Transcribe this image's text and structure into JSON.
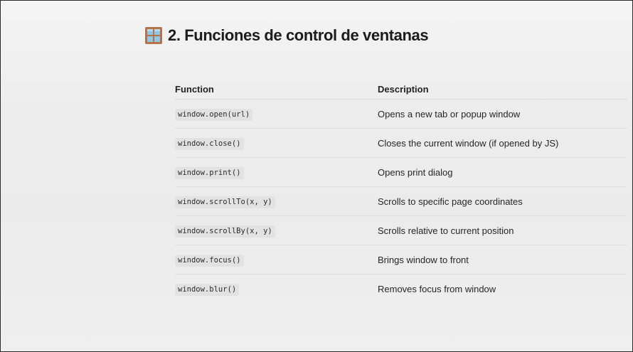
{
  "heading": {
    "icon": "window-icon",
    "title": "2. Funciones de control de ventanas"
  },
  "table": {
    "columns": [
      "Function",
      "Description"
    ],
    "rows": [
      {
        "function": "window.open(url)",
        "description": "Opens a new tab or popup window"
      },
      {
        "function": "window.close()",
        "description": "Closes the current window (if opened by JS)"
      },
      {
        "function": "window.print()",
        "description": "Opens print dialog"
      },
      {
        "function": "window.scrollTo(x, y)",
        "description": "Scrolls to specific page coordinates"
      },
      {
        "function": "window.scrollBy(x, y)",
        "description": "Scrolls relative to current position"
      },
      {
        "function": "window.focus()",
        "description": "Brings window to front"
      },
      {
        "function": "window.blur()",
        "description": "Removes focus from window"
      }
    ]
  },
  "colors": {
    "icon_frame": "#b5734a",
    "icon_glass": "#8ec7e8"
  }
}
